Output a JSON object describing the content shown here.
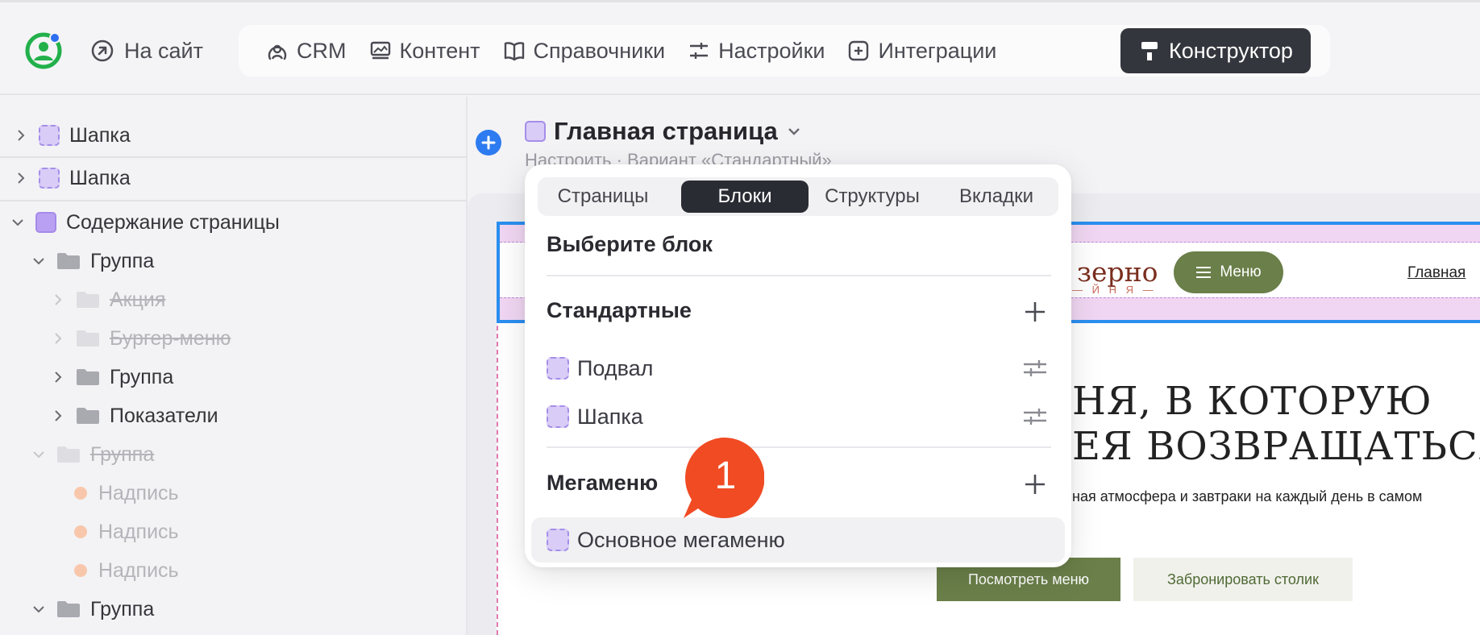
{
  "topbar": {
    "site_link": "На сайт",
    "nav": [
      {
        "label": "CRM",
        "icon": "crm-icon"
      },
      {
        "label": "Контент",
        "icon": "content-icon"
      },
      {
        "label": "Справочники",
        "icon": "book-icon"
      },
      {
        "label": "Настройки",
        "icon": "sliders-icon"
      },
      {
        "label": "Интеграции",
        "icon": "plus-square-icon"
      },
      {
        "label": "Конструктор",
        "icon": "paint-roller-icon",
        "active": true
      }
    ]
  },
  "sidebar": {
    "items": [
      {
        "label": "Шапка"
      },
      {
        "label": "Шапка"
      },
      {
        "label": "Содержание страницы"
      },
      {
        "label": "Группа"
      },
      {
        "label": "Акция",
        "hidden": true
      },
      {
        "label": "Бургер-меню",
        "hidden": true
      },
      {
        "label": "Группа"
      },
      {
        "label": "Показатели"
      },
      {
        "label": "Группа",
        "hidden": true
      },
      {
        "label": "Надпись",
        "hidden": true
      },
      {
        "label": "Надпись",
        "hidden": true
      },
      {
        "label": "Надпись",
        "hidden": true
      },
      {
        "label": "Группа"
      }
    ]
  },
  "main": {
    "page_title": "Главная страница",
    "page_subtitle": "Настроить · Вариант «Стандартный»"
  },
  "popup": {
    "tabs": [
      "Страницы",
      "Блоки",
      "Структуры",
      "Вкладки"
    ],
    "active_tab": "Блоки",
    "heading": "Выберите блок",
    "sections": [
      {
        "title": "Стандартные",
        "items": [
          "Подвал",
          "Шапка"
        ]
      },
      {
        "title": "Мегаменю",
        "items": [
          "Основное мегаменю"
        ]
      }
    ]
  },
  "badge": {
    "number": "1"
  },
  "preview": {
    "brand": "зерно",
    "brand_sub": "— Й Н Я —",
    "menu_button": "Меню",
    "home_link": "Главная",
    "hero_line1": "НЯ, В КОТОРУЮ",
    "hero_line2": "ЕЯ ВОЗВРАЩАТЬСЯ",
    "hero_text": "ная атмосфера и завтраки на каждый день в самом",
    "btn_menu": "Посмотреть меню",
    "btn_book": "Забронировать столик"
  },
  "colors": {
    "accent_dark": "#34363d",
    "selection_blue": "#2b8ff0",
    "badge_red": "#f04b23",
    "block_purple": "#d9ccf7",
    "preview_green": "#6a7f49"
  }
}
